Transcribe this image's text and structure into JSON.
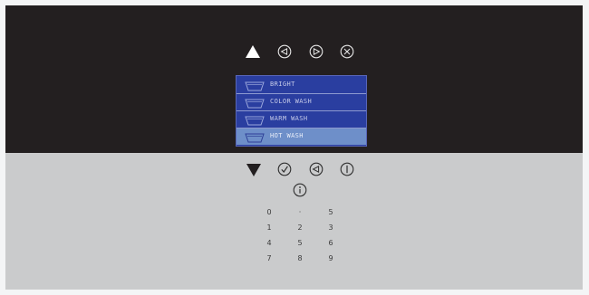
{
  "colors": {
    "display_background": "#231f20",
    "panel_background": "#cacbcc",
    "menu_background": "#2a3ea0",
    "menu_selected": "#6e8fc9"
  },
  "top_icons": [
    "up-arrow-icon",
    "left-arrow-icon",
    "right-arrow-icon",
    "close-icon"
  ],
  "menu": {
    "items": [
      {
        "label": "BRIGHT",
        "selected": false
      },
      {
        "label": "COLOR WASH",
        "selected": false
      },
      {
        "label": "WARM WASH",
        "selected": false
      },
      {
        "label": "HOT WASH",
        "selected": true
      }
    ]
  },
  "bottom_icons": [
    "down-arrow-icon",
    "check-icon",
    "back-icon",
    "power-icon",
    "info-icon"
  ],
  "keypad": {
    "keys": [
      "0",
      "·",
      "5",
      "1",
      "2",
      "3",
      "4",
      "5",
      "6",
      "7",
      "8",
      "9"
    ]
  }
}
